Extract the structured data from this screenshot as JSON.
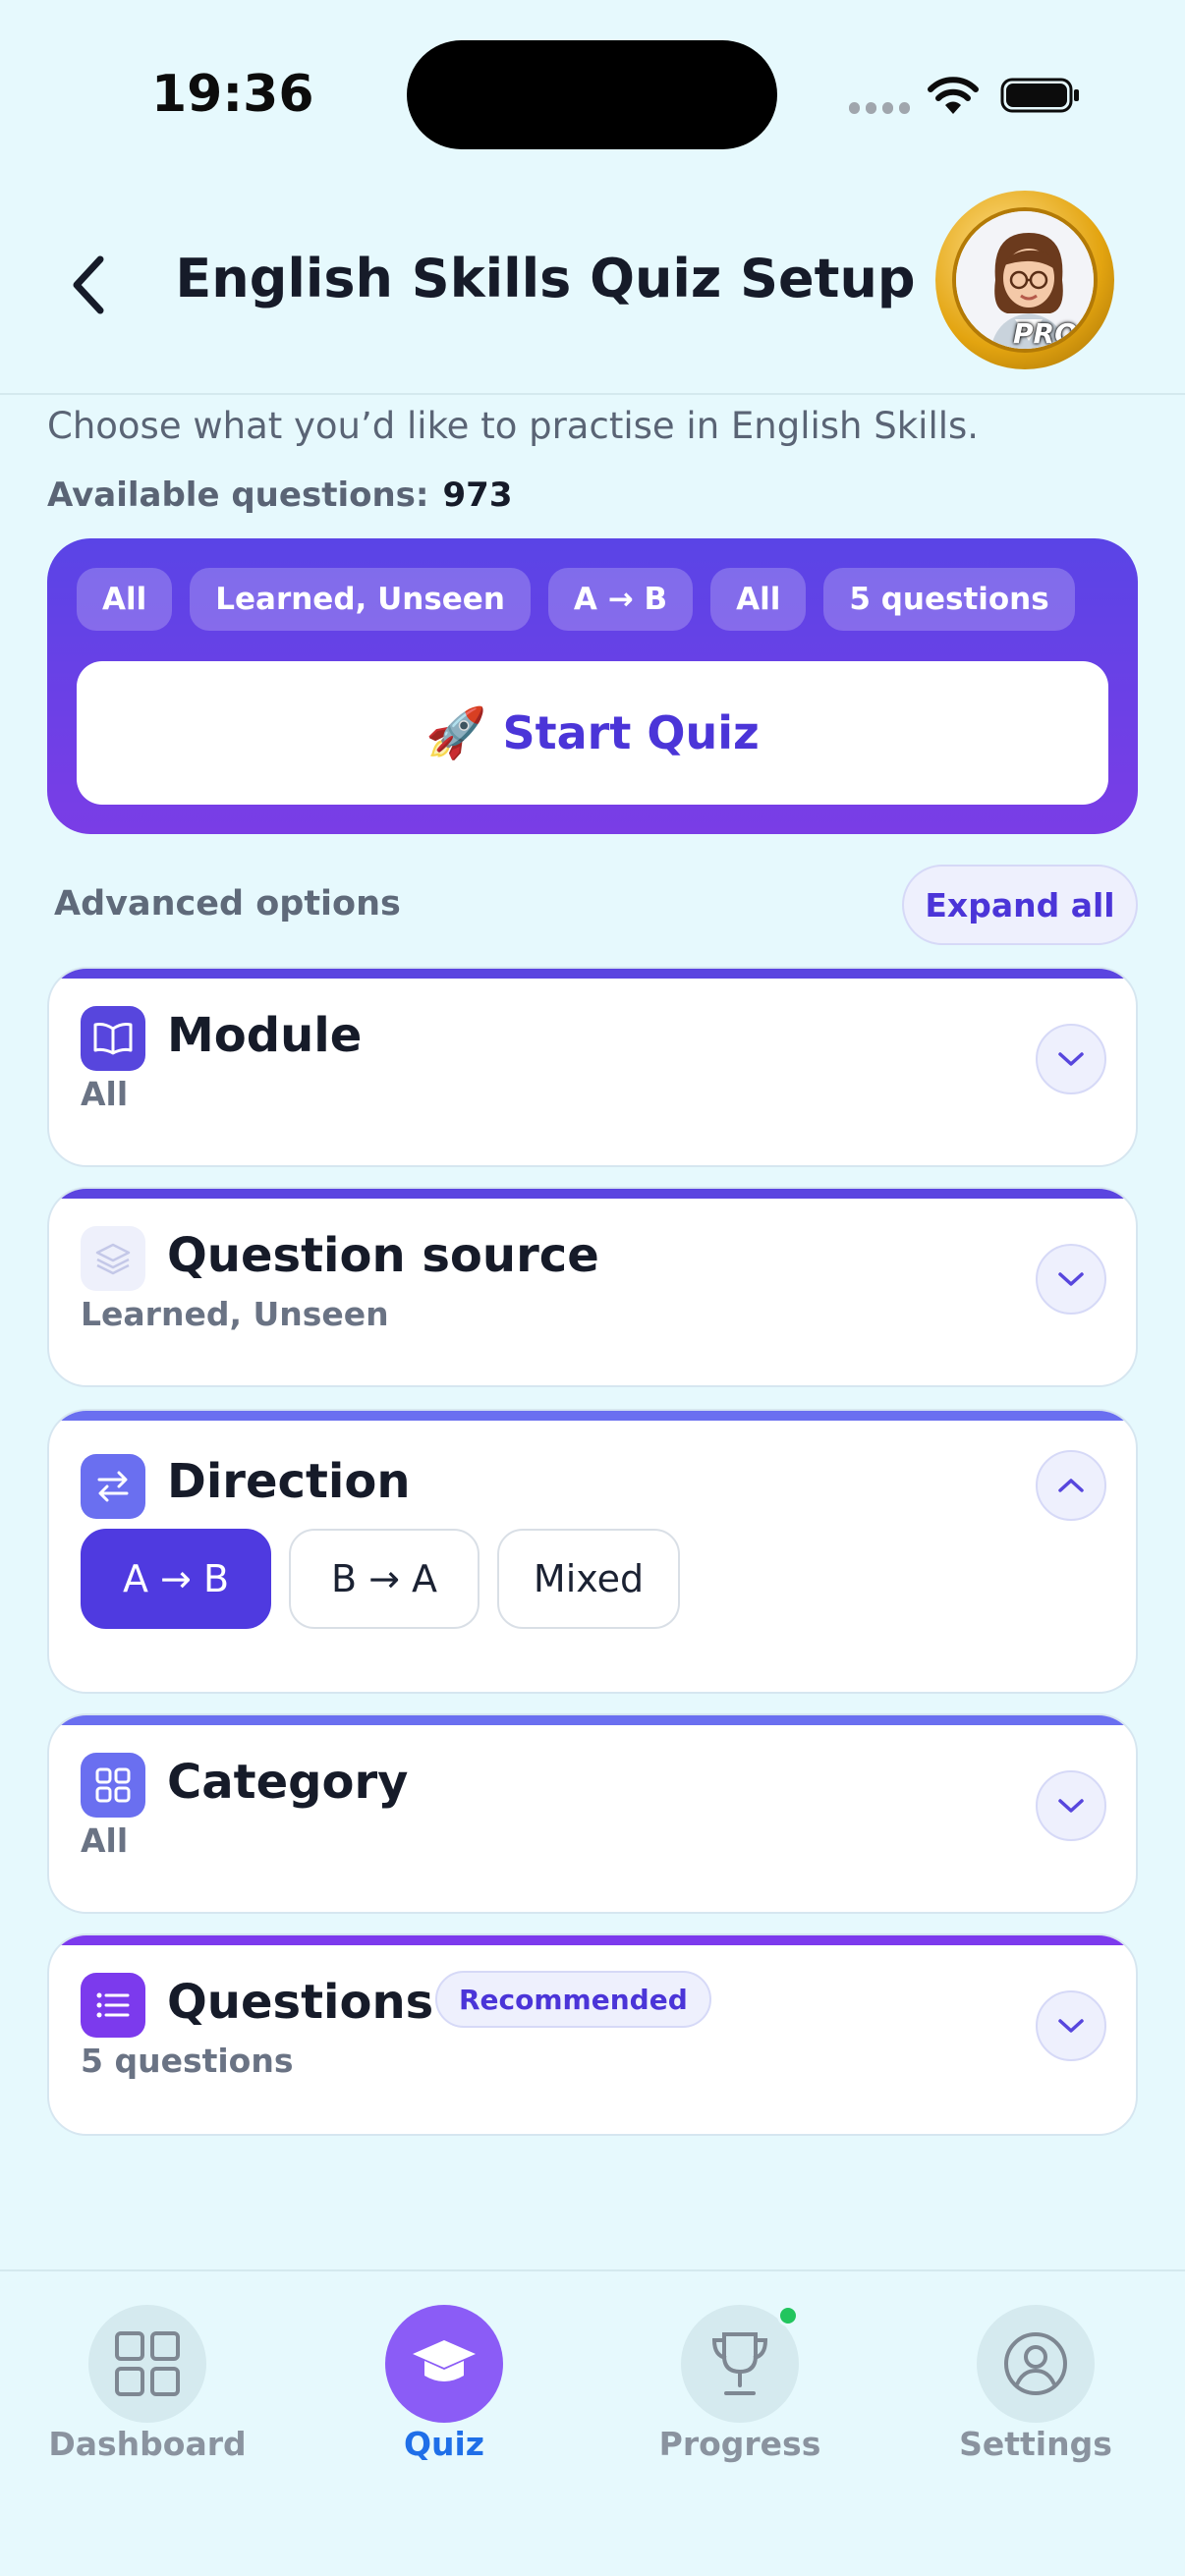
{
  "status_bar": {
    "time": "19:36"
  },
  "header": {
    "title": "English Skills Quiz Setup",
    "badge": "PRO"
  },
  "intro": {
    "subtitle": "Choose what you’d like to practise in English Skills.",
    "available_label": "Available questions:",
    "available_count": "973"
  },
  "summary": {
    "chips": [
      "All",
      "Learned, Unseen",
      "A → B",
      "All",
      "5 questions"
    ],
    "start_label": "Start Quiz",
    "start_emoji": "🚀"
  },
  "advanced": {
    "label": "Advanced options",
    "expand_label": "Expand all"
  },
  "sections": {
    "module": {
      "title": "Module",
      "value": "All"
    },
    "source": {
      "title": "Question source",
      "value": "Learned, Unseen"
    },
    "direction": {
      "title": "Direction",
      "options": [
        "A → B",
        "B → A",
        "Mixed"
      ],
      "selected": "A → B"
    },
    "category": {
      "title": "Category",
      "value": "All"
    },
    "questions": {
      "title": "Questions",
      "badge": "Recommended",
      "value": "5 questions"
    }
  },
  "bottom_nav": {
    "items": [
      {
        "label": "Dashboard",
        "icon": "grid-icon"
      },
      {
        "label": "Quiz",
        "icon": "graduation-cap-icon",
        "active": true
      },
      {
        "label": "Progress",
        "icon": "trophy-icon"
      },
      {
        "label": "Settings",
        "icon": "user-circle-icon"
      }
    ]
  },
  "colors": {
    "accent": "#4f3ae0",
    "background": "#e6f9fd",
    "active_nav": "#1f6fe8",
    "notification": "#22c55e"
  }
}
